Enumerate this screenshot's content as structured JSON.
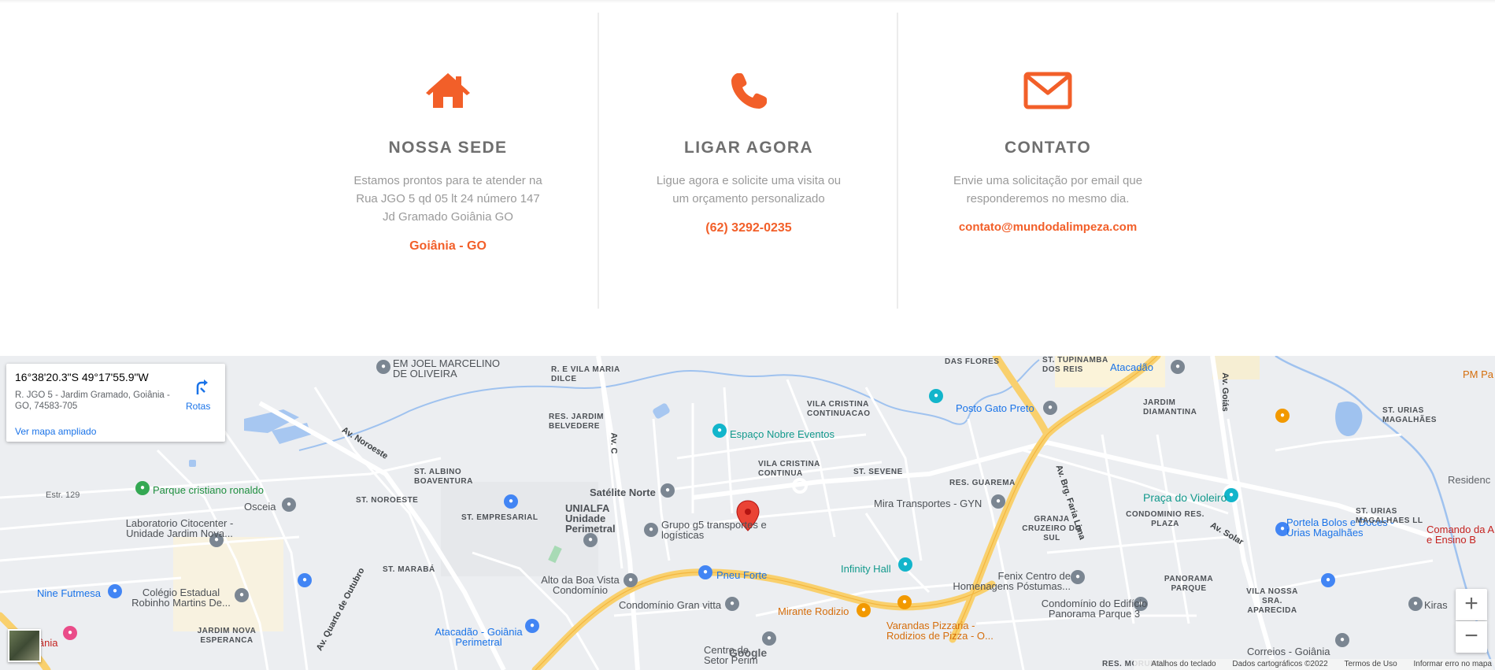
{
  "contact": {
    "col1": {
      "icon": "house-icon",
      "title": "NOSSA SEDE",
      "text": [
        "Estamos prontos para te atender na",
        "Rua JGO 5 qd 05 lt 24 número 147",
        "Jd Gramado Goiânia GO"
      ],
      "link": "Goiânia - GO"
    },
    "col2": {
      "icon": "phone-icon",
      "title": "LIGAR AGORA",
      "text": [
        "Ligue agora e solicite uma visita ou",
        "um orçamento personalizado"
      ],
      "link": "(62) 3292-0235"
    },
    "col3": {
      "icon": "mail-icon",
      "title": "CONTATO",
      "text": [
        "Envie uma solicitação por email que",
        "responderemos no mesmo dia."
      ],
      "link": "contato@mundodalimpeza.com"
    },
    "accent_color": "#f25f29"
  },
  "map": {
    "info_card": {
      "coords": "16°38'20.3\"S 49°17'55.9\"W",
      "address": "R. JGO 5 - Jardim Gramado, Goiânia - GO, 74583-705",
      "link": "Ver mapa ampliado",
      "directions": "Rotas"
    },
    "labels": {
      "l1": "EM JOEL MARCELINO DE OLIVEIRA",
      "l2": "R. E VILA MARIA DILCE",
      "l3": "Atacadão",
      "l4": "ST. TUPINAMBA DOS REIS",
      "l5": "DAS FLORES",
      "l6": "PM Pa",
      "l7": "Posto Gato Preto",
      "l8": "JARDIM DIAMANTINA",
      "l9": "ST. URIAS MAGALHÃES",
      "l10": "Espaço Nobre Eventos",
      "l11": "RES. JARDIM BELVEDERE",
      "l12": "VILA CRISTINA CONTINUACAO",
      "l13": "Av. Noroeste",
      "l14": "ST. ALBINO BOAVENTURA",
      "l15": "VILA CRISTINA CONTINUA",
      "l16": "ST. SEVENE",
      "l17": "RES. GUAREMA",
      "l18": "Estr. 129",
      "l19": "Parque cristiano ronaldo",
      "l20": "ST. NOROESTE",
      "l21": "Satélite Norte",
      "l22": "Mira Transportes - GYN",
      "l23": "Praça do Violeiro",
      "l24": "Residenc",
      "l25": "Osceia",
      "l26": "ST. EMPRESARIAL",
      "l27": "UNIALFA Unidade Perimetral",
      "l28": "Grupo g5 transportes e logísticas",
      "l29": "Laboratorio Citocenter - Unidade Jardim Nova...",
      "l30": "CONDOMINIO RES. PLAZA",
      "l31": "GRANJA CRUZEIRO DO SUL",
      "l32": "Portela Bolos e Doces - Urias Magalhães",
      "l33": "ST. URIAS MAGALHAES LL",
      "l34": "Comando da A e Ensino B",
      "l35": "ST. MARABÁ",
      "l36": "Pneu Forte",
      "l37": "Infinity Hall",
      "l38": "Alto da Boa Vista Condomínio",
      "l39": "Fenix Centro de Homenagens Póstumas...",
      "l40": "PANORAMA PARQUE",
      "l41": "VILA NOSSA SRA. APARECIDA",
      "l42": "Nine Futmesa",
      "l43": "Colégio Estadual Robinho Martins De...",
      "l44": "Condomínio Gran vitta",
      "l45": "Mirante Rodizio",
      "l46": "Condomínio do Edifício Panorama Parque 3",
      "l47": "Kiras",
      "l48": "Varandas Pizzaria - Rodizios de Pizza - O...",
      "l49": "JARDIM NOVA ESPERANCA",
      "l50": "Atacadão - Goiânia Perimetral",
      "l51": "Centro de Setor Perim",
      "l52": "RES. MORUMBI",
      "l53": "Correios - Goiânia",
      "l54": "Av. Quarto de Outubro",
      "l55": "Av. Brg. Faria Lima",
      "l56": "Av. Solar",
      "l57": "Av. Goiás",
      "l58": "iânia",
      "l59": "Google",
      "l60": "Av. C",
      "l61": "ST. NOROESTE"
    },
    "footer": {
      "shortcuts": "Atalhos do teclado",
      "data": "Dados cartográficos ©2022",
      "terms": "Termos de Uso",
      "report": "Informar erro no mapa"
    },
    "zoom_in": "+",
    "zoom_out": "−"
  }
}
